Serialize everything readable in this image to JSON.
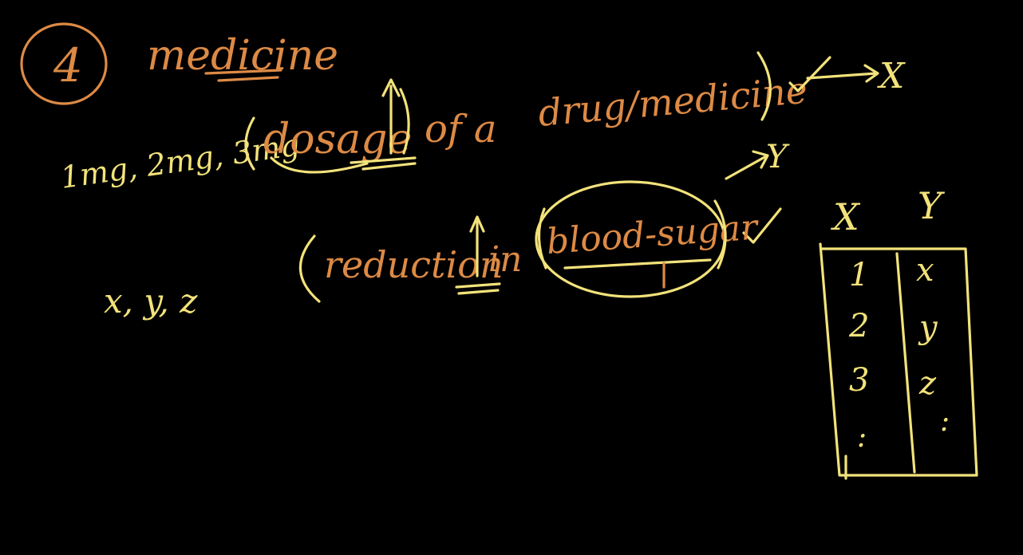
{
  "colors": {
    "background": "#000000",
    "orange_ink": "#dd8a45",
    "yellow_ink": "#f2e27a"
  },
  "board": {
    "circled_number": "4",
    "heading": "medicine",
    "doses": "1mg, 2mg, 3mg",
    "dosage_word": "dosage",
    "of_a_phrase": "of a",
    "drug_word": "drug/medicine",
    "x_arrow_label": "X",
    "y_arrow_label": "Y",
    "reduction_word": "reduction",
    "in_word": "in",
    "blood_sugar_word": "blood-sugar",
    "xyz": "x, y, z"
  },
  "table": {
    "headers": [
      "X",
      "Y"
    ],
    "rows": [
      [
        "1",
        "x"
      ],
      [
        "2",
        "y"
      ],
      [
        "3",
        "z"
      ],
      [
        ":",
        ":"
      ]
    ]
  }
}
